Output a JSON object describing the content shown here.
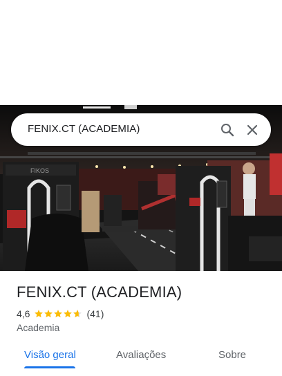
{
  "search": {
    "query": "FENIX.CT (ACADEMIA)"
  },
  "place": {
    "title": "FENIX.CT (ACADEMIA)",
    "rating": "4,6",
    "rating_value": 4.6,
    "review_count": "(41)",
    "category": "Academia"
  },
  "tabs": [
    {
      "label": "Visão geral",
      "active": true
    },
    {
      "label": "Avaliações",
      "active": false
    },
    {
      "label": "Sobre",
      "active": false
    }
  ],
  "photo": {
    "machine_brand": "FIKOS"
  },
  "colors": {
    "accent": "#1a73e8",
    "star": "#fbbc04",
    "text_primary": "#202124",
    "text_secondary": "#5f6368"
  }
}
